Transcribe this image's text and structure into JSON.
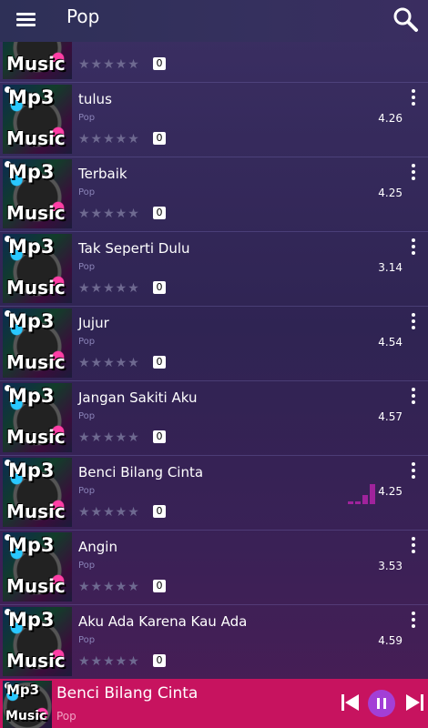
{
  "appbar": {
    "title": "Pop",
    "menu_icon": "hamburger-menu-icon",
    "search_icon": "search-icon"
  },
  "thumbnail": {
    "top_text": "Mp3",
    "bottom_text": "Music"
  },
  "songs": [
    {
      "title": "",
      "genre": "",
      "stars": "★★★★★",
      "count": "0",
      "rating": ""
    },
    {
      "title": "tulus",
      "genre": "Pop",
      "stars": "★★★★★",
      "count": "0",
      "rating": "4.26"
    },
    {
      "title": "Terbaik",
      "genre": "Pop",
      "stars": "★★★★★",
      "count": "0",
      "rating": "4.25"
    },
    {
      "title": "Tak Seperti Dulu",
      "genre": "Pop",
      "stars": "★★★★★",
      "count": "0",
      "rating": "3.14"
    },
    {
      "title": "Jujur",
      "genre": "Pop",
      "stars": "★★★★★",
      "count": "0",
      "rating": "4.54"
    },
    {
      "title": "Jangan Sakiti Aku",
      "genre": "Pop",
      "stars": "★★★★★",
      "count": "0",
      "rating": "4.57"
    },
    {
      "title": "Benci Bilang Cinta",
      "genre": "Pop",
      "stars": "★★★★★",
      "count": "0",
      "rating": "4.25",
      "playing": true
    },
    {
      "title": "Angin",
      "genre": "Pop",
      "stars": "★★★★★",
      "count": "0",
      "rating": "3.53"
    },
    {
      "title": "Aku Ada Karena Kau Ada",
      "genre": "Pop",
      "stars": "★★★★★",
      "count": "0",
      "rating": "4.59"
    }
  ],
  "player": {
    "title": "Benci Bilang Cinta",
    "genre": "Pop",
    "accent": "#c7135f"
  },
  "colors": {
    "background": "#2f2453",
    "playing_indicator": "#a0239c"
  }
}
